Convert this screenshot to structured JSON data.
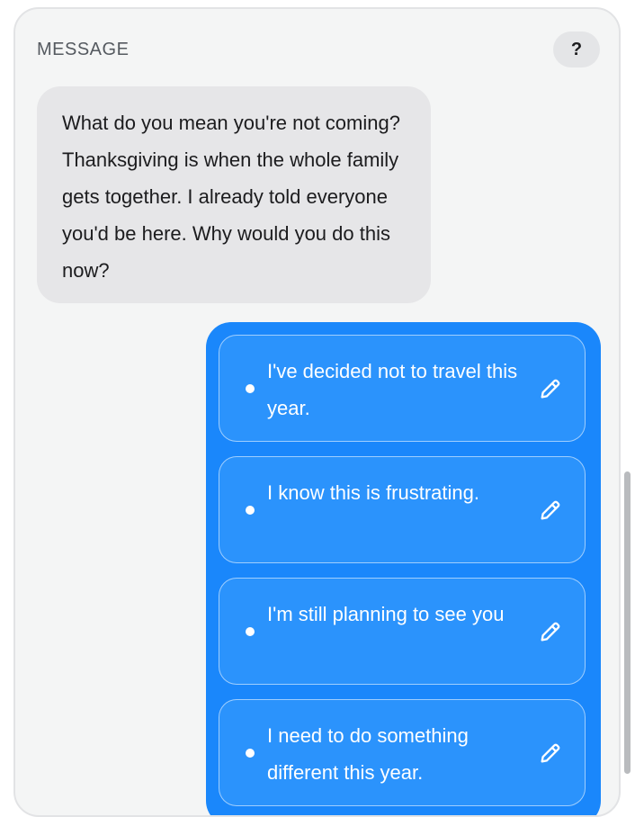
{
  "header": {
    "label": "MESSAGE",
    "help_label": "?"
  },
  "incoming_message": {
    "text": "What do you mean you're not coming? Thanksgiving is when the whole family gets together. I already told everyone you'd be here. Why would you do this now?"
  },
  "reply_options": [
    {
      "text": "I've decided not to travel this year.",
      "icon": "pencil-edit-icon"
    },
    {
      "text": "I know this is frustrating.",
      "icon": "pencil-edit-icon"
    },
    {
      "text": "I'm still planning to see you",
      "icon": "pencil-edit-icon"
    },
    {
      "text": "I need to do something different this year.",
      "icon": "pencil-edit-icon"
    }
  ],
  "colors": {
    "panel_background": "#f4f5f5",
    "incoming_bubble": "#e6e6e8",
    "reply_bubble": "#1a87fb",
    "option_card": "#2b93fc"
  }
}
